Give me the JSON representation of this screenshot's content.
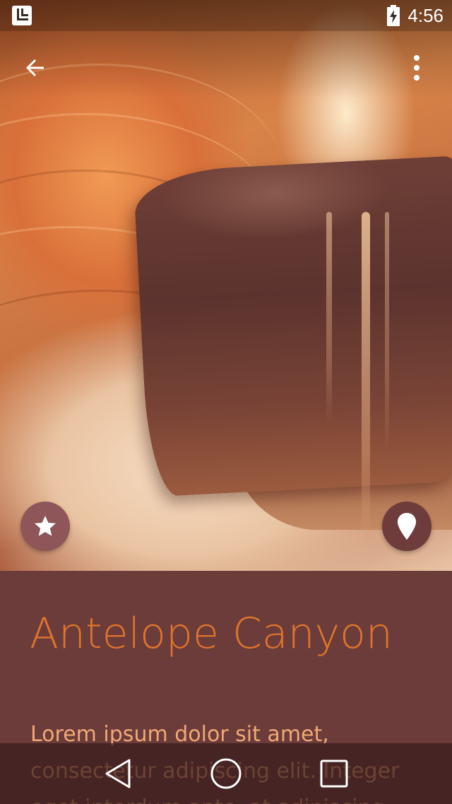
{
  "status_bar": {
    "time": "4:56",
    "app_icon": "launcher-logo-icon",
    "battery_icon": "battery-charging-icon"
  },
  "app_bar": {
    "back_icon": "arrow-back-icon",
    "overflow_icon": "more-vertical-icon"
  },
  "hero": {
    "fab_favorite_icon": "star-icon",
    "fab_location_icon": "map-pin-icon"
  },
  "content": {
    "title": "Antelope Canyon",
    "body": "Lorem ipsum dolor sit amet, consectetur adipiscing elit. Integer eget interdum ante, at adipiscing"
  },
  "nav_bar": {
    "back_icon": "nav-back-triangle-icon",
    "home_icon": "nav-home-circle-icon",
    "recents_icon": "nav-recents-square-icon"
  },
  "colors": {
    "panel_background": "#6b3c3a",
    "title_color": "#e0742b",
    "body_color": "#f0a876",
    "fab_favorite": "#8e5658",
    "fab_location": "#6e3c3b"
  }
}
